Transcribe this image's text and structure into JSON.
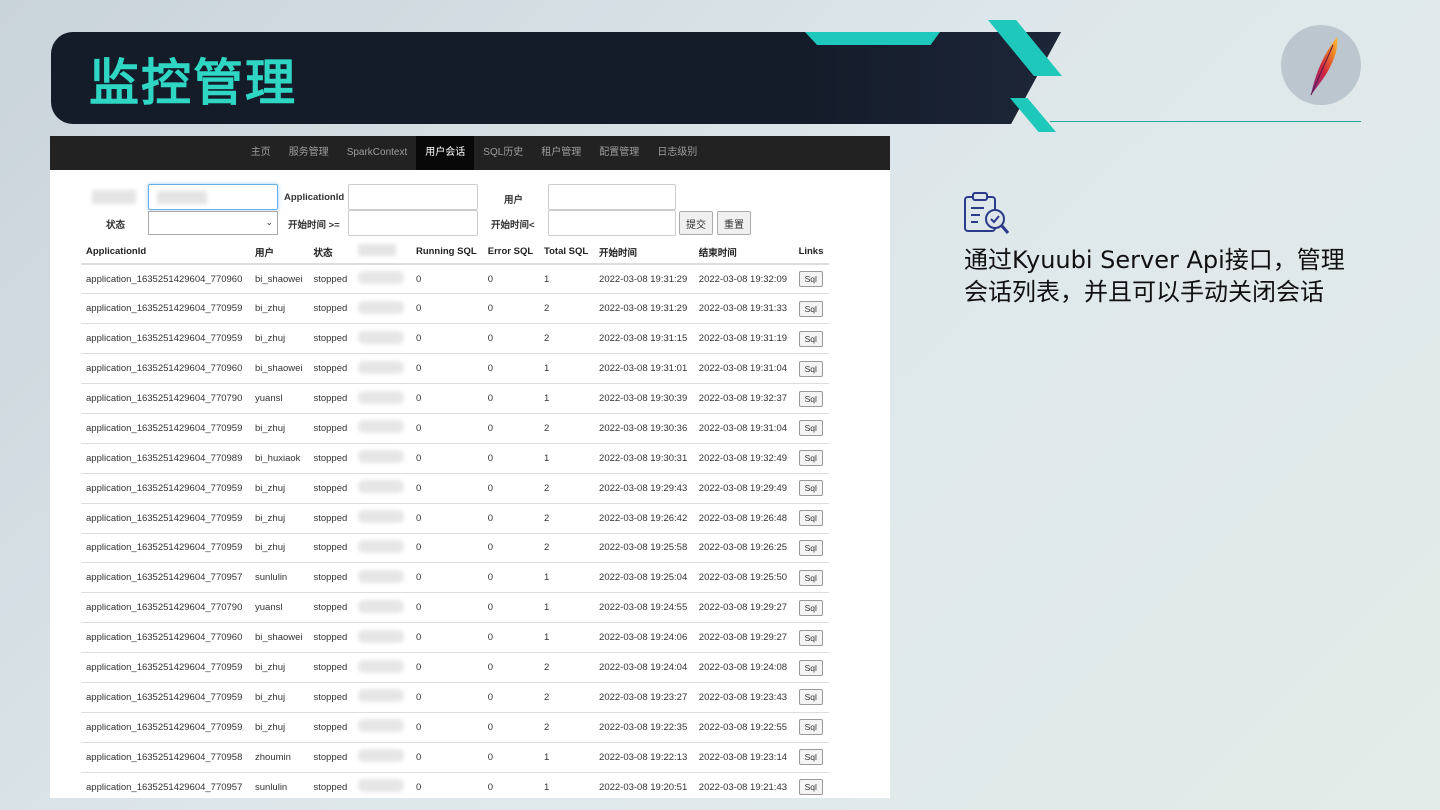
{
  "slide": {
    "title": "监控管理",
    "description": "通过Kyuubi Server Api接口，管理会话列表，并且可以手动关闭会话"
  },
  "app": {
    "nav": [
      {
        "label": "主页",
        "active": false
      },
      {
        "label": "服务管理",
        "active": false
      },
      {
        "label": "SparkContext",
        "active": false
      },
      {
        "label": "用户会话",
        "active": true
      },
      {
        "label": "SQL历史",
        "active": false
      },
      {
        "label": "租户管理",
        "active": false
      },
      {
        "label": "配置管理",
        "active": false
      },
      {
        "label": "日志级别",
        "active": false
      }
    ],
    "filters": {
      "application_id_label": "ApplicationId",
      "user_label": "用户",
      "status_label": "状态",
      "start_ge_label": "开始时间 >=",
      "start_lt_label": "开始时间<",
      "submit_label": "提交",
      "reset_label": "重置"
    },
    "table": {
      "headers": [
        "ApplicationId",
        "用户",
        "状态",
        "",
        "Running SQL",
        "Error SQL",
        "Total SQL",
        "开始时间",
        "结束时间",
        "Links"
      ],
      "link_label": "Sql",
      "rows": [
        {
          "app_id": "application_1635251429604_770960",
          "user": "bi_shaowei",
          "status": "stopped",
          "running": "0",
          "error": "0",
          "total": "1",
          "start": "2022-03-08 19:31:29",
          "end": "2022-03-08 19:32:09"
        },
        {
          "app_id": "application_1635251429604_770959",
          "user": "bi_zhuj",
          "status": "stopped",
          "running": "0",
          "error": "0",
          "total": "2",
          "start": "2022-03-08 19:31:29",
          "end": "2022-03-08 19:31:33"
        },
        {
          "app_id": "application_1635251429604_770959",
          "user": "bi_zhuj",
          "status": "stopped",
          "running": "0",
          "error": "0",
          "total": "2",
          "start": "2022-03-08 19:31:15",
          "end": "2022-03-08 19:31:19"
        },
        {
          "app_id": "application_1635251429604_770960",
          "user": "bi_shaowei",
          "status": "stopped",
          "running": "0",
          "error": "0",
          "total": "1",
          "start": "2022-03-08 19:31:01",
          "end": "2022-03-08 19:31:04"
        },
        {
          "app_id": "application_1635251429604_770790",
          "user": "yuansl",
          "status": "stopped",
          "running": "0",
          "error": "0",
          "total": "1",
          "start": "2022-03-08 19:30:39",
          "end": "2022-03-08 19:32:37"
        },
        {
          "app_id": "application_1635251429604_770959",
          "user": "bi_zhuj",
          "status": "stopped",
          "running": "0",
          "error": "0",
          "total": "2",
          "start": "2022-03-08 19:30:36",
          "end": "2022-03-08 19:31:04"
        },
        {
          "app_id": "application_1635251429604_770989",
          "user": "bi_huxiaok",
          "status": "stopped",
          "running": "0",
          "error": "0",
          "total": "1",
          "start": "2022-03-08 19:30:31",
          "end": "2022-03-08 19:32:49"
        },
        {
          "app_id": "application_1635251429604_770959",
          "user": "bi_zhuj",
          "status": "stopped",
          "running": "0",
          "error": "0",
          "total": "2",
          "start": "2022-03-08 19:29:43",
          "end": "2022-03-08 19:29:49"
        },
        {
          "app_id": "application_1635251429604_770959",
          "user": "bi_zhuj",
          "status": "stopped",
          "running": "0",
          "error": "0",
          "total": "2",
          "start": "2022-03-08 19:26:42",
          "end": "2022-03-08 19:26:48"
        },
        {
          "app_id": "application_1635251429604_770959",
          "user": "bi_zhuj",
          "status": "stopped",
          "running": "0",
          "error": "0",
          "total": "2",
          "start": "2022-03-08 19:25:58",
          "end": "2022-03-08 19:26:25"
        },
        {
          "app_id": "application_1635251429604_770957",
          "user": "sunlulin",
          "status": "stopped",
          "running": "0",
          "error": "0",
          "total": "1",
          "start": "2022-03-08 19:25:04",
          "end": "2022-03-08 19:25:50"
        },
        {
          "app_id": "application_1635251429604_770790",
          "user": "yuansl",
          "status": "stopped",
          "running": "0",
          "error": "0",
          "total": "1",
          "start": "2022-03-08 19:24:55",
          "end": "2022-03-08 19:29:27"
        },
        {
          "app_id": "application_1635251429604_770960",
          "user": "bi_shaowei",
          "status": "stopped",
          "running": "0",
          "error": "0",
          "total": "1",
          "start": "2022-03-08 19:24:06",
          "end": "2022-03-08 19:29:27"
        },
        {
          "app_id": "application_1635251429604_770959",
          "user": "bi_zhuj",
          "status": "stopped",
          "running": "0",
          "error": "0",
          "total": "2",
          "start": "2022-03-08 19:24:04",
          "end": "2022-03-08 19:24:08"
        },
        {
          "app_id": "application_1635251429604_770959",
          "user": "bi_zhuj",
          "status": "stopped",
          "running": "0",
          "error": "0",
          "total": "2",
          "start": "2022-03-08 19:23:27",
          "end": "2022-03-08 19:23:43"
        },
        {
          "app_id": "application_1635251429604_770959",
          "user": "bi_zhuj",
          "status": "stopped",
          "running": "0",
          "error": "0",
          "total": "2",
          "start": "2022-03-08 19:22:35",
          "end": "2022-03-08 19:22:55"
        },
        {
          "app_id": "application_1635251429604_770958",
          "user": "zhoumin",
          "status": "stopped",
          "running": "0",
          "error": "0",
          "total": "1",
          "start": "2022-03-08 19:22:13",
          "end": "2022-03-08 19:23:14"
        },
        {
          "app_id": "application_1635251429604_770957",
          "user": "sunlulin",
          "status": "stopped",
          "running": "0",
          "error": "0",
          "total": "1",
          "start": "2022-03-08 19:20:51",
          "end": "2022-03-08 19:21:43"
        }
      ]
    }
  },
  "icons": {
    "logo": "feather-logo-icon",
    "description": "clipboard-check-icon"
  },
  "colors": {
    "accent": "#1ec9bb",
    "title_text": "#2fd6c3",
    "header_bar": "#141c2a",
    "link": "#337ab7"
  }
}
